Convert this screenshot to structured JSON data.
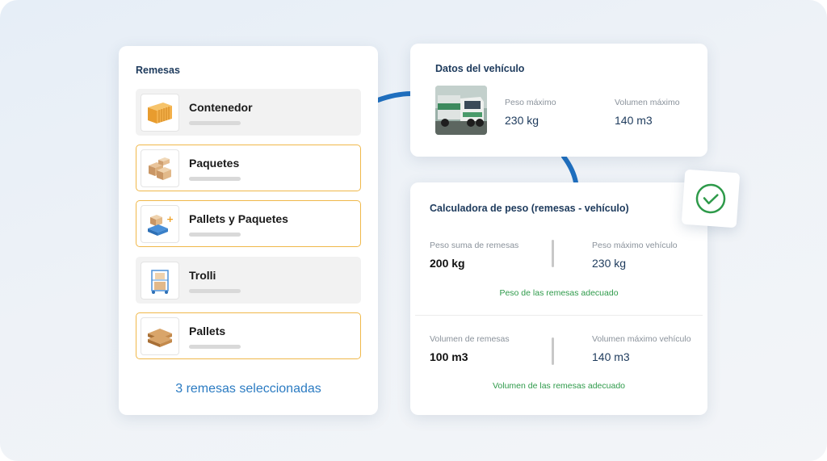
{
  "remesas": {
    "title": "Remesas",
    "items": [
      {
        "label": "Contenedor",
        "icon": "container-icon",
        "selected": false
      },
      {
        "label": "Paquetes",
        "icon": "boxes-icon",
        "selected": true
      },
      {
        "label": "Pallets y Paquetes",
        "icon": "pallet-boxes-icon",
        "selected": true
      },
      {
        "label": "Trolli",
        "icon": "trolley-icon",
        "selected": false
      },
      {
        "label": "Pallets",
        "icon": "pallets-icon",
        "selected": true
      }
    ],
    "selected_count_text": "3 remesas seleccionadas"
  },
  "vehicle": {
    "title": "Datos del vehículo",
    "image_icon": "truck-photo",
    "peso_label": "Peso máximo",
    "peso_value": "230 kg",
    "volumen_label": "Volumen máximo",
    "volumen_value": "140 m3"
  },
  "calculator": {
    "title": "Calculadora de peso (remesas - vehículo)",
    "peso": {
      "left_label": "Peso suma de remesas",
      "left_value": "200 kg",
      "right_label": "Peso máximo vehículo",
      "right_value": "230 kg",
      "status": "Peso de las remesas adecuado"
    },
    "volumen": {
      "left_label": "Volumen de remesas",
      "left_value": "100 m3",
      "right_label": "Volumen máximo vehículo",
      "right_value": "140 m3",
      "status": "Volumen de las remesas adecuado"
    },
    "badge_icon": "check-circle-icon"
  },
  "colors": {
    "accent_blue": "#2b7bc2",
    "title_navy": "#1d3a5c",
    "selected_border": "#f0b84a",
    "success_green": "#2e9a4a"
  }
}
